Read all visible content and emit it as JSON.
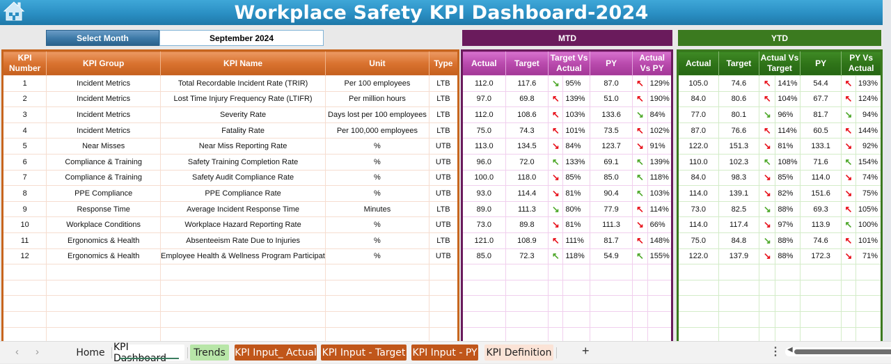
{
  "header": {
    "title": "Workplace Safety KPI Dashboard-2024",
    "home_icon": "home-icon"
  },
  "month_selector": {
    "label": "Select Month",
    "value": "September 2024"
  },
  "bands": {
    "mtd": "MTD",
    "ytd": "YTD"
  },
  "colors": {
    "title_blue": "#2a8fc3",
    "kpi_orange": "#c7651e",
    "mtd_purple": "#6a1b5c",
    "ytd_green": "#3b7a1f",
    "arrow_red": "#e8101a",
    "arrow_green": "#4ea82a"
  },
  "main_columns": [
    "KPI Number",
    "KPI Group",
    "KPI Name",
    "Unit",
    "Type"
  ],
  "mtd_columns": [
    "Actual",
    "Target",
    "Target Vs Actual",
    "PY",
    "Actual Vs PY"
  ],
  "ytd_columns": [
    "Actual",
    "Target",
    "Actual Vs Target",
    "PY",
    "PY Vs Actual"
  ],
  "rows": [
    {
      "num": "1",
      "group": "Incident Metrics",
      "name": "Total Recordable Incident Rate (TRIR)",
      "unit": "Per 100 employees",
      "type": "LTB",
      "mtd": {
        "actual": "112.0",
        "target": "117.6",
        "tva_dir": "down",
        "tva_color": "green",
        "tva": "95%",
        "py": "87.0",
        "avp_dir": "up",
        "avp_color": "red",
        "avp": "129%"
      },
      "ytd": {
        "actual": "105.0",
        "target": "74.6",
        "avt_dir": "up",
        "avt_color": "red",
        "avt": "141%",
        "py": "54.4",
        "pva_dir": "up",
        "pva_color": "red",
        "pva": "193%"
      }
    },
    {
      "num": "2",
      "group": "Incident Metrics",
      "name": "Lost Time Injury Frequency Rate (LTIFR)",
      "unit": "Per million hours",
      "type": "LTB",
      "mtd": {
        "actual": "97.0",
        "target": "69.8",
        "tva_dir": "up",
        "tva_color": "red",
        "tva": "139%",
        "py": "51.0",
        "avp_dir": "up",
        "avp_color": "red",
        "avp": "190%"
      },
      "ytd": {
        "actual": "84.0",
        "target": "80.6",
        "avt_dir": "up",
        "avt_color": "red",
        "avt": "104%",
        "py": "67.7",
        "pva_dir": "up",
        "pva_color": "red",
        "pva": "124%"
      }
    },
    {
      "num": "3",
      "group": "Incident Metrics",
      "name": "Severity Rate",
      "unit": "Days lost per 100 employees",
      "type": "LTB",
      "mtd": {
        "actual": "112.0",
        "target": "108.6",
        "tva_dir": "up",
        "tva_color": "red",
        "tva": "103%",
        "py": "133.6",
        "avp_dir": "down",
        "avp_color": "green",
        "avp": "84%"
      },
      "ytd": {
        "actual": "77.0",
        "target": "80.1",
        "avt_dir": "down",
        "avt_color": "green",
        "avt": "96%",
        "py": "81.7",
        "pva_dir": "down",
        "pva_color": "green",
        "pva": "94%"
      }
    },
    {
      "num": "4",
      "group": "Incident Metrics",
      "name": "Fatality Rate",
      "unit": "Per 100,000 employees",
      "type": "LTB",
      "mtd": {
        "actual": "75.0",
        "target": "74.3",
        "tva_dir": "up",
        "tva_color": "red",
        "tva": "101%",
        "py": "73.5",
        "avp_dir": "up",
        "avp_color": "red",
        "avp": "102%"
      },
      "ytd": {
        "actual": "87.0",
        "target": "76.6",
        "avt_dir": "up",
        "avt_color": "red",
        "avt": "114%",
        "py": "60.5",
        "pva_dir": "up",
        "pva_color": "red",
        "pva": "144%"
      }
    },
    {
      "num": "5",
      "group": "Near Misses",
      "name": "Near Miss Reporting Rate",
      "unit": "%",
      "type": "UTB",
      "mtd": {
        "actual": "113.0",
        "target": "134.5",
        "tva_dir": "down",
        "tva_color": "red",
        "tva": "84%",
        "py": "123.7",
        "avp_dir": "down",
        "avp_color": "red",
        "avp": "91%"
      },
      "ytd": {
        "actual": "122.0",
        "target": "151.3",
        "avt_dir": "down",
        "avt_color": "red",
        "avt": "81%",
        "py": "133.1",
        "pva_dir": "down",
        "pva_color": "red",
        "pva": "92%"
      }
    },
    {
      "num": "6",
      "group": "Compliance & Training",
      "name": "Safety Training Completion Rate",
      "unit": "%",
      "type": "UTB",
      "mtd": {
        "actual": "96.0",
        "target": "72.0",
        "tva_dir": "up",
        "tva_color": "green",
        "tva": "133%",
        "py": "69.1",
        "avp_dir": "up",
        "avp_color": "green",
        "avp": "139%"
      },
      "ytd": {
        "actual": "110.0",
        "target": "102.3",
        "avt_dir": "up",
        "avt_color": "green",
        "avt": "108%",
        "py": "71.6",
        "pva_dir": "up",
        "pva_color": "green",
        "pva": "154%"
      }
    },
    {
      "num": "7",
      "group": "Compliance & Training",
      "name": "Safety Audit Compliance Rate",
      "unit": "%",
      "type": "UTB",
      "mtd": {
        "actual": "100.0",
        "target": "118.0",
        "tva_dir": "down",
        "tva_color": "red",
        "tva": "85%",
        "py": "85.0",
        "avp_dir": "up",
        "avp_color": "green",
        "avp": "118%"
      },
      "ytd": {
        "actual": "84.0",
        "target": "98.3",
        "avt_dir": "down",
        "avt_color": "red",
        "avt": "85%",
        "py": "114.0",
        "pva_dir": "down",
        "pva_color": "red",
        "pva": "74%"
      }
    },
    {
      "num": "8",
      "group": "PPE Compliance",
      "name": "PPE Compliance Rate",
      "unit": "%",
      "type": "UTB",
      "mtd": {
        "actual": "93.0",
        "target": "114.4",
        "tva_dir": "down",
        "tva_color": "red",
        "tva": "81%",
        "py": "90.4",
        "avp_dir": "up",
        "avp_color": "green",
        "avp": "103%"
      },
      "ytd": {
        "actual": "114.0",
        "target": "139.1",
        "avt_dir": "down",
        "avt_color": "red",
        "avt": "82%",
        "py": "151.6",
        "pva_dir": "down",
        "pva_color": "red",
        "pva": "75%"
      }
    },
    {
      "num": "9",
      "group": "Response Time",
      "name": "Average Incident Response Time",
      "unit": "Minutes",
      "type": "LTB",
      "mtd": {
        "actual": "89.0",
        "target": "111.3",
        "tva_dir": "down",
        "tva_color": "green",
        "tva": "80%",
        "py": "77.9",
        "avp_dir": "up",
        "avp_color": "red",
        "avp": "114%"
      },
      "ytd": {
        "actual": "73.0",
        "target": "82.5",
        "avt_dir": "down",
        "avt_color": "green",
        "avt": "88%",
        "py": "69.3",
        "pva_dir": "up",
        "pva_color": "red",
        "pva": "105%"
      }
    },
    {
      "num": "10",
      "group": "Workplace Conditions",
      "name": "Workplace Hazard Reporting Rate",
      "unit": "%",
      "type": "UTB",
      "mtd": {
        "actual": "73.0",
        "target": "89.8",
        "tva_dir": "down",
        "tva_color": "red",
        "tva": "81%",
        "py": "111.3",
        "avp_dir": "down",
        "avp_color": "red",
        "avp": "66%"
      },
      "ytd": {
        "actual": "114.0",
        "target": "117.4",
        "avt_dir": "down",
        "avt_color": "red",
        "avt": "97%",
        "py": "113.9",
        "pva_dir": "up",
        "pva_color": "green",
        "pva": "100%"
      }
    },
    {
      "num": "11",
      "group": "Ergonomics & Health",
      "name": "Absenteeism Rate Due to Injuries",
      "unit": "%",
      "type": "LTB",
      "mtd": {
        "actual": "121.0",
        "target": "108.9",
        "tva_dir": "up",
        "tva_color": "red",
        "tva": "111%",
        "py": "81.7",
        "avp_dir": "up",
        "avp_color": "red",
        "avp": "148%"
      },
      "ytd": {
        "actual": "75.0",
        "target": "84.8",
        "avt_dir": "down",
        "avt_color": "green",
        "avt": "88%",
        "py": "74.6",
        "pva_dir": "up",
        "pva_color": "red",
        "pva": "101%"
      }
    },
    {
      "num": "12",
      "group": "Ergonomics & Health",
      "name": "Employee Health & Wellness Program Participation",
      "unit": "%",
      "type": "UTB",
      "mtd": {
        "actual": "85.0",
        "target": "72.3",
        "tva_dir": "up",
        "tva_color": "green",
        "tva": "118%",
        "py": "54.9",
        "avp_dir": "up",
        "avp_color": "green",
        "avp": "155%"
      },
      "ytd": {
        "actual": "122.0",
        "target": "137.9",
        "avt_dir": "down",
        "avt_color": "red",
        "avt": "88%",
        "py": "172.3",
        "pva_dir": "down",
        "pva_color": "red",
        "pva": "71%"
      }
    }
  ],
  "empty_rows": 5,
  "arrows": {
    "up": "↖",
    "down": "↘"
  },
  "sheet_tabs": {
    "prev": "‹",
    "next": "›",
    "home": "Home",
    "kpi_dashboard": "KPI Dashboard",
    "trends": "Trends",
    "kpi_input_actual": "KPI Input_ Actual",
    "kpi_input_target": "KPI Input - Target",
    "kpi_input_py": "KPI Input - PY",
    "kpi_definition": "KPI Definition",
    "add": "+",
    "more": "⋮"
  }
}
